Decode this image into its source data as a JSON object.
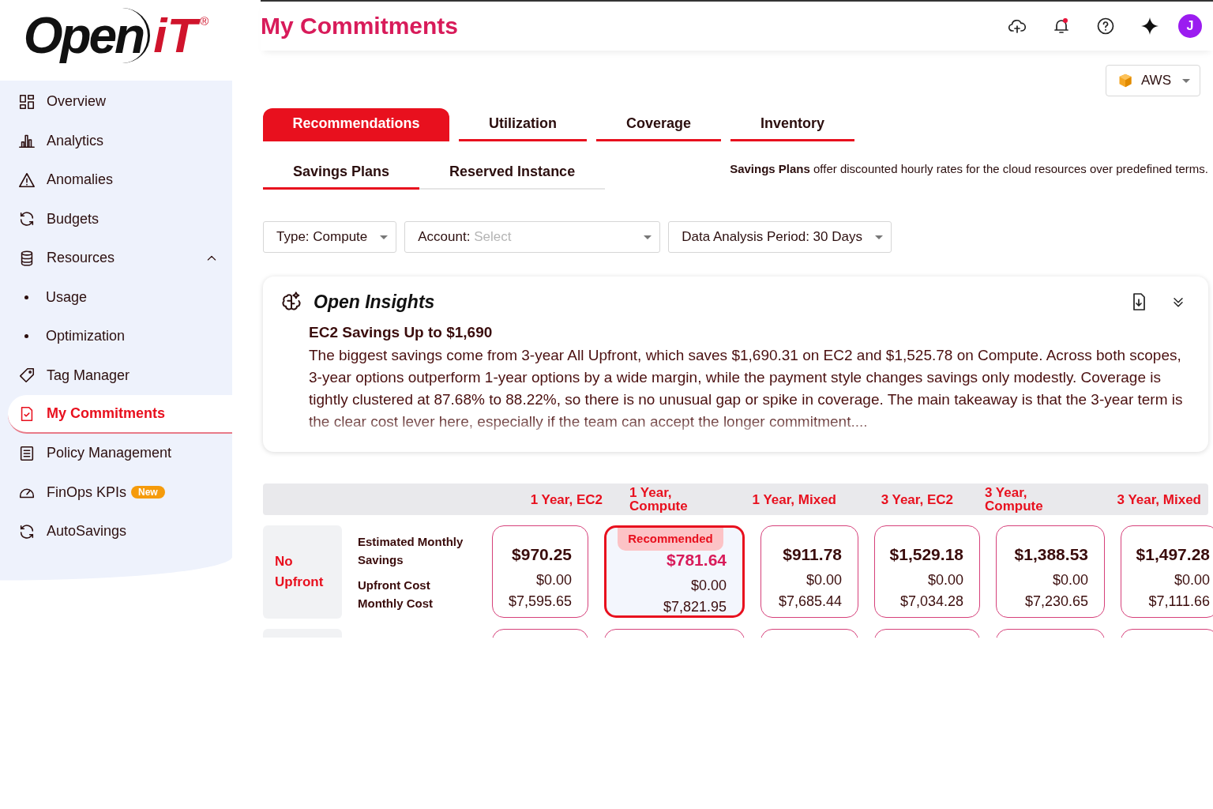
{
  "logo": {
    "word": "Open",
    "mark": "iT",
    "registered": "®"
  },
  "sidebar": {
    "items": [
      {
        "label": "Overview",
        "kind": "item",
        "selected": false
      },
      {
        "label": "Analytics",
        "kind": "item",
        "selected": false
      },
      {
        "label": "Anomalies",
        "kind": "item",
        "selected": false
      },
      {
        "label": "Budgets",
        "kind": "item",
        "selected": false
      },
      {
        "label": "Resources",
        "kind": "group",
        "selected": false,
        "expanded": true,
        "children": [
          {
            "label": "Usage",
            "kind": "sub",
            "selected": false
          },
          {
            "label": "Optimization",
            "kind": "sub",
            "selected": false
          }
        ]
      },
      {
        "label": "Tag Manager",
        "kind": "item",
        "selected": false
      },
      {
        "label": "My Commitments",
        "kind": "item",
        "selected": true
      },
      {
        "label": "Policy Management",
        "kind": "item",
        "selected": false
      },
      {
        "label": "FinOps KPIs",
        "kind": "item",
        "selected": false,
        "badge": "New"
      },
      {
        "label": "AutoSavings",
        "kind": "item",
        "selected": false
      }
    ]
  },
  "header": {
    "title": "My Commitments",
    "avatar": "J",
    "notification": true
  },
  "provider": {
    "value": "AWS"
  },
  "tabs": [
    {
      "label": "Recommendations",
      "selected": true
    },
    {
      "label": "Utilization",
      "selected": false
    },
    {
      "label": "Coverage",
      "selected": false
    },
    {
      "label": "Inventory",
      "selected": false
    }
  ],
  "subtabs": [
    {
      "label": "Savings Plans",
      "selected": true
    },
    {
      "label": "Reserved Instance",
      "selected": false
    }
  ],
  "info": "**Savings Plans** offer discounted hourly rates for the cloud resources over predefined terms.",
  "filters": [
    {
      "label": "Type: Compute"
    },
    {
      "label": "Account:",
      "placeholder": "Select"
    },
    {
      "label": "Data Analysis Period: 30 Days"
    }
  ],
  "insights": {
    "title": "Open Insights",
    "expanded": false,
    "headline": "EC2 Savings Up to $1,690",
    "body": "The biggest savings come from 3-year All Upfront, which saves $1,690.31 on EC2 and $1,525.78 on Compute. Across both scopes, 3-year options outperform 1-year options by a wide margin, while the payment style changes savings only modestly. Coverage is tightly clustered at 87.68% to 88.22%, so there is no unusual gap or spike in coverage. The main takeaway is that the 3-year term is the clear cost lever here, especially if the team can accept the longer commitment...."
  },
  "table": {
    "columns": [
      "1 Year, EC2",
      "1 Year, Compute",
      "1 Year, Mixed",
      "3 Year, EC2",
      "3 Year, Compute",
      "3 Year, Mixed"
    ],
    "metrics": [
      "Estimated Monthly Savings",
      "Upfront Cost",
      "Monthly Cost"
    ],
    "rows": [
      {
        "kind": "full",
        "label": "No Upfront",
        "cards": [
          {
            "savings": "$970.25",
            "upfront": "$0.00",
            "monthly": "$7,595.65",
            "recommended": false
          },
          {
            "savings": "$781.64",
            "upfront": "$0.00",
            "monthly": "$7,821.95",
            "recommended": true,
            "badge": "Recommended"
          },
          {
            "savings": "$911.78",
            "upfront": "$0.00",
            "monthly": "$7,685.44",
            "recommended": false
          },
          {
            "savings": "$1,529.18",
            "upfront": "$0.00",
            "monthly": "$7,034.28",
            "recommended": false
          },
          {
            "savings": "$1,388.53",
            "upfront": "$0.00",
            "monthly": "$7,230.65",
            "recommended": false
          },
          {
            "savings": "$1,497.28",
            "upfront": "$0.00",
            "monthly": "$7,111.66",
            "recommended": false
          }
        ]
      },
      {
        "kind": "cut"
      }
    ]
  }
}
